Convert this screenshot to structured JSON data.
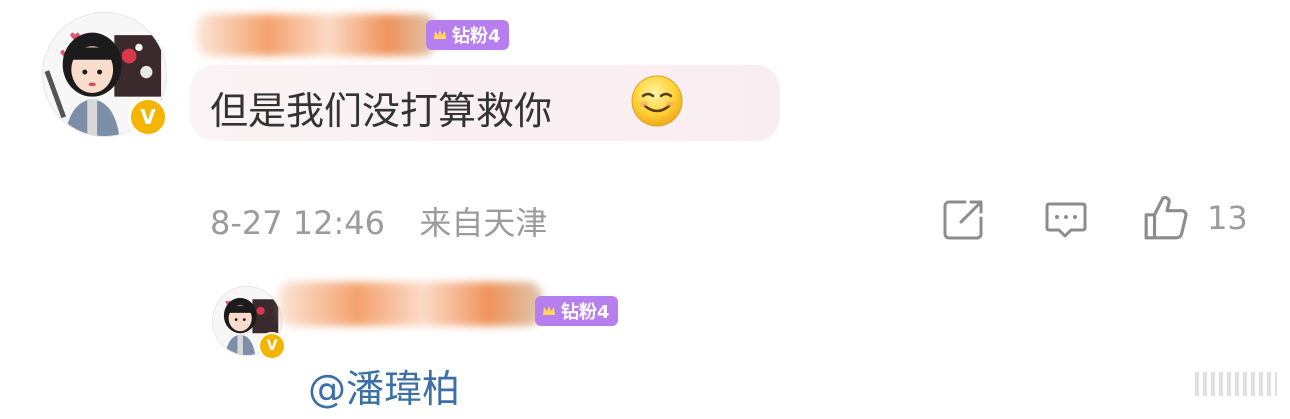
{
  "comment": {
    "fan_badge_label": "钻粉4",
    "text": "但是我们没打算救你",
    "emoji": "smile-emoji",
    "timestamp": "8-27 12:46",
    "location": "来自天津",
    "like_count": "13",
    "verified_badge": "V"
  },
  "reply": {
    "fan_badge_label": "钻粉4",
    "verified_badge": "V",
    "mention": "@潘瑋柏"
  },
  "icons": {
    "repost": "repost-icon",
    "comment": "comment-icon",
    "like": "thumbs-up-icon"
  },
  "colors": {
    "fan_badge": "#b77ef0",
    "verified": "#f5b400",
    "mention": "#3c6fa6",
    "meta_text": "#9b9b9b"
  }
}
